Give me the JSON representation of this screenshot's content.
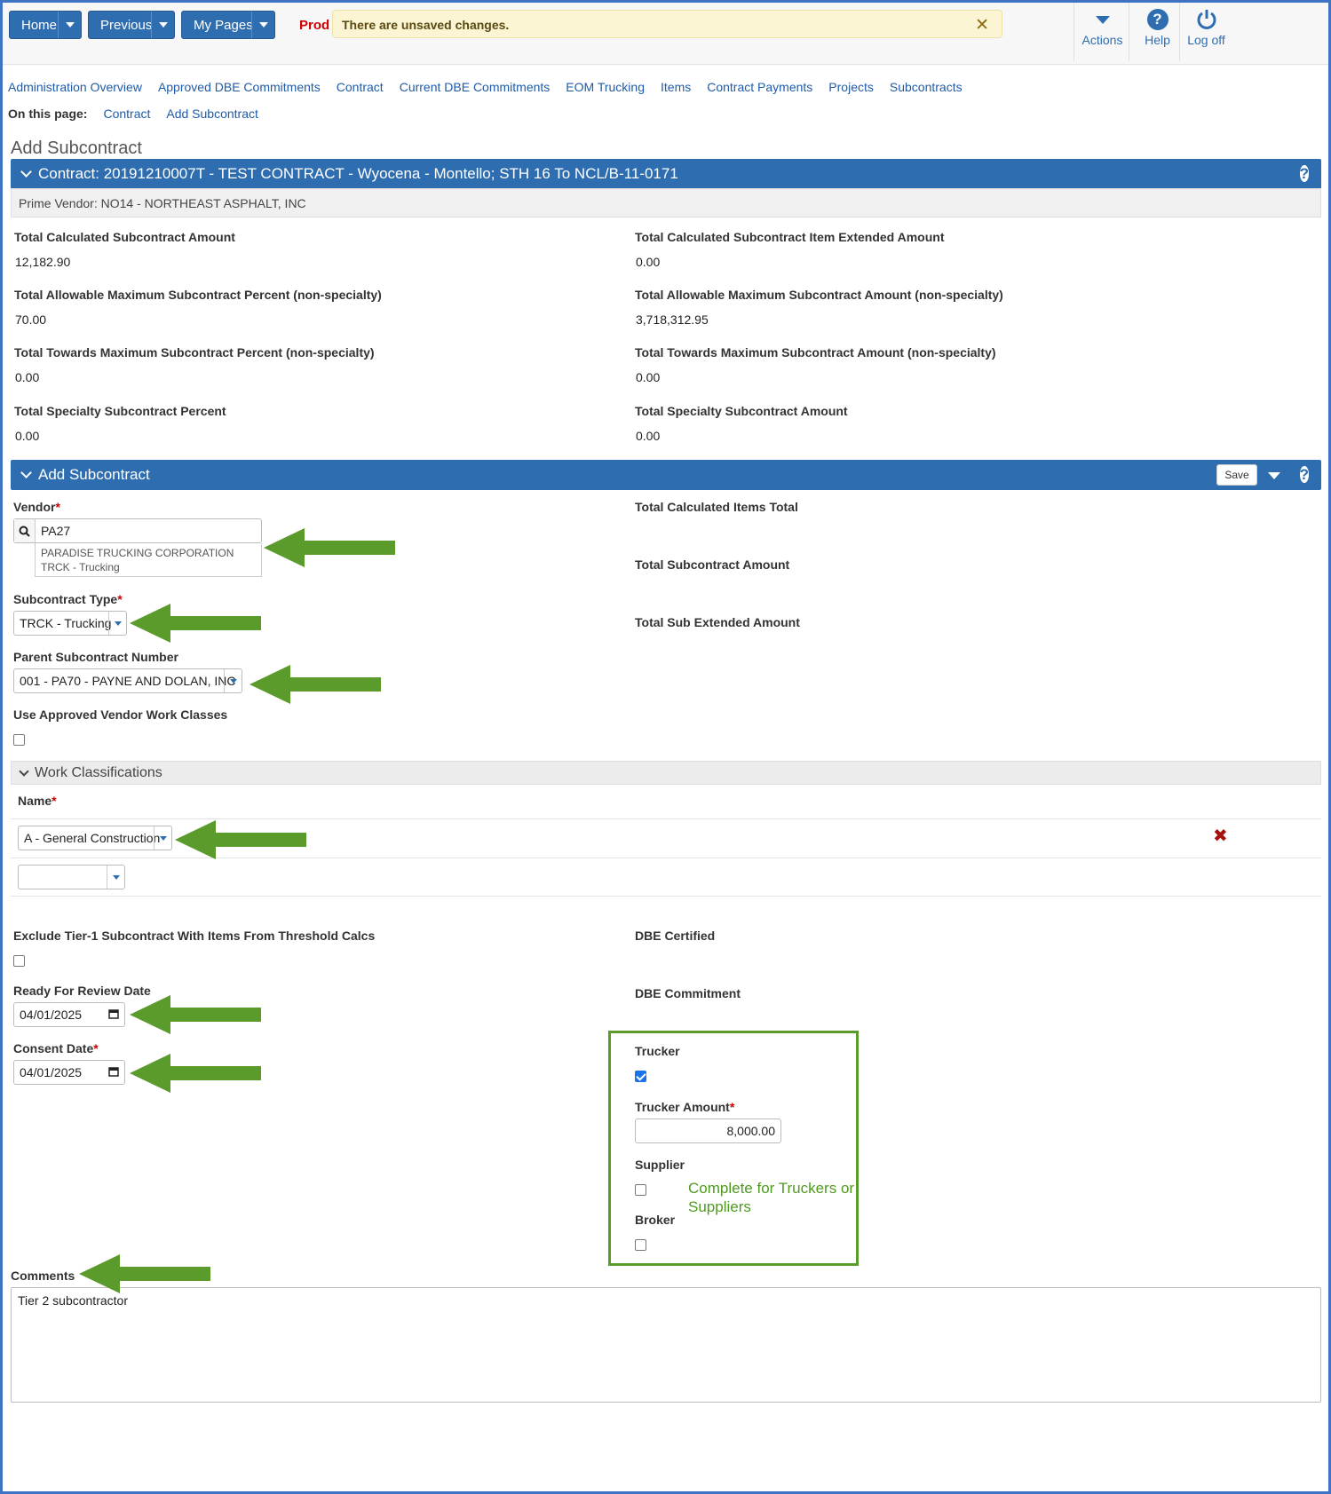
{
  "topbar": {
    "home": "Home",
    "previous": "Previous",
    "my_pages": "My Pages",
    "env": "Prod",
    "unsaved_msg": "There are unsaved changes.",
    "actions": "Actions",
    "help": "Help",
    "logoff": "Log off"
  },
  "links": [
    "Administration Overview",
    "Approved DBE Commitments",
    "Contract",
    "Current DBE Commitments",
    "EOM Trucking",
    "Items",
    "Contract Payments",
    "Projects",
    "Subcontracts"
  ],
  "on_this_page": {
    "label": "On this page:",
    "items": [
      "Contract",
      "Add Subcontract"
    ]
  },
  "page_title": "Add Subcontract",
  "contract_panel": {
    "title": "Contract: 20191210007T - TEST CONTRACT - Wyocena - Montello; STH 16 To NCL/B-11-0171",
    "prime_vendor": "Prime Vendor: NO14 - NORTHEAST ASPHALT, INC",
    "fields": [
      {
        "label": "Total Calculated Subcontract Amount",
        "value": "12,182.90"
      },
      {
        "label": "Total Calculated Subcontract Item Extended Amount",
        "value": "0.00"
      },
      {
        "label": "Total Allowable Maximum Subcontract Percent (non-specialty)",
        "value": "70.00"
      },
      {
        "label": "Total Allowable Maximum Subcontract Amount (non-specialty)",
        "value": "3,718,312.95"
      },
      {
        "label": "Total Towards Maximum Subcontract Percent (non-specialty)",
        "value": "0.00"
      },
      {
        "label": "Total Towards Maximum Subcontract Amount (non-specialty)",
        "value": "0.00"
      },
      {
        "label": "Total Specialty Subcontract Percent",
        "value": "0.00"
      },
      {
        "label": "Total Specialty Subcontract Amount",
        "value": "0.00"
      }
    ]
  },
  "add_panel": {
    "title": "Add Subcontract",
    "save": "Save",
    "vendor_label": "Vendor",
    "vendor_value": "PA27",
    "vendor_suggestion": "PARADISE TRUCKING CORPORATION TRCK - Trucking",
    "subcontract_type_label": "Subcontract Type",
    "subcontract_type_value": "TRCK - Trucking",
    "parent_label": "Parent Subcontract Number",
    "parent_value": "001 - PA70 - PAYNE AND DOLAN, INC",
    "use_approved_label": "Use Approved Vendor Work Classes",
    "total_calc_items": "Total Calculated Items Total",
    "total_sub_amount": "Total Subcontract Amount",
    "total_sub_extended": "Total Sub Extended Amount"
  },
  "work_classifications": {
    "title": "Work Classifications",
    "name_label": "Name",
    "row1_value": "A - General Construction",
    "row2_value": ""
  },
  "lower": {
    "exclude_label": "Exclude Tier-1 Subcontract With Items From Threshold Calcs",
    "ready_label": "Ready For Review Date",
    "ready_value": "04/01/2025",
    "consent_label": "Consent Date",
    "consent_value": "04/01/2025",
    "dbe_certified": "DBE Certified",
    "dbe_commitment": "DBE Commitment",
    "trucker_label": "Trucker",
    "trucker_checked": true,
    "trucker_amount_label": "Trucker Amount",
    "trucker_amount_value": "8,000.00",
    "supplier_label": "Supplier",
    "broker_label": "Broker",
    "note": "Complete for Truckers or Suppliers",
    "comments_label": "Comments",
    "comments_value": "Tier 2 subcontractor"
  },
  "colors": {
    "primary": "#2f6db1",
    "arrow": "#5b9b2b",
    "required": "#cc0000",
    "warning_bg": "#fcf5d3"
  }
}
